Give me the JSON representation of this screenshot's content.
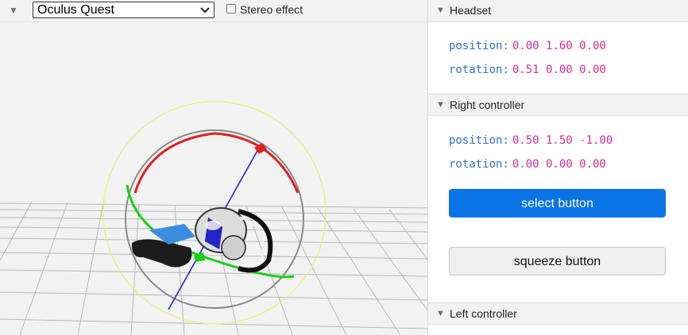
{
  "toolbar": {
    "device_selected": "Oculus Quest",
    "stereo_label": "Stereo effect",
    "stereo_checked": false
  },
  "panel": {
    "headset": {
      "title": "Headset",
      "position_label": "position:",
      "position_value": "0.00 1.60 0.00",
      "rotation_label": "rotation:",
      "rotation_value": "0.51 0.00 0.00"
    },
    "right_controller": {
      "title": "Right controller",
      "position_label": "position:",
      "position_value": "0.50 1.50 -1.00",
      "rotation_label": "rotation:",
      "rotation_value": "0.00 0.00 0.00",
      "select_label": "select button",
      "squeeze_label": "squeeze button"
    },
    "left_controller": {
      "title": "Left controller"
    }
  },
  "colors": {
    "accent": "#0a74e6",
    "label": "#2f6fce",
    "value": "#d62a9a",
    "gizmo_x": "#e02020",
    "gizmo_y": "#18d018",
    "gizmo_z": "#2424e0",
    "gizmo_outer": "#e8f070"
  }
}
